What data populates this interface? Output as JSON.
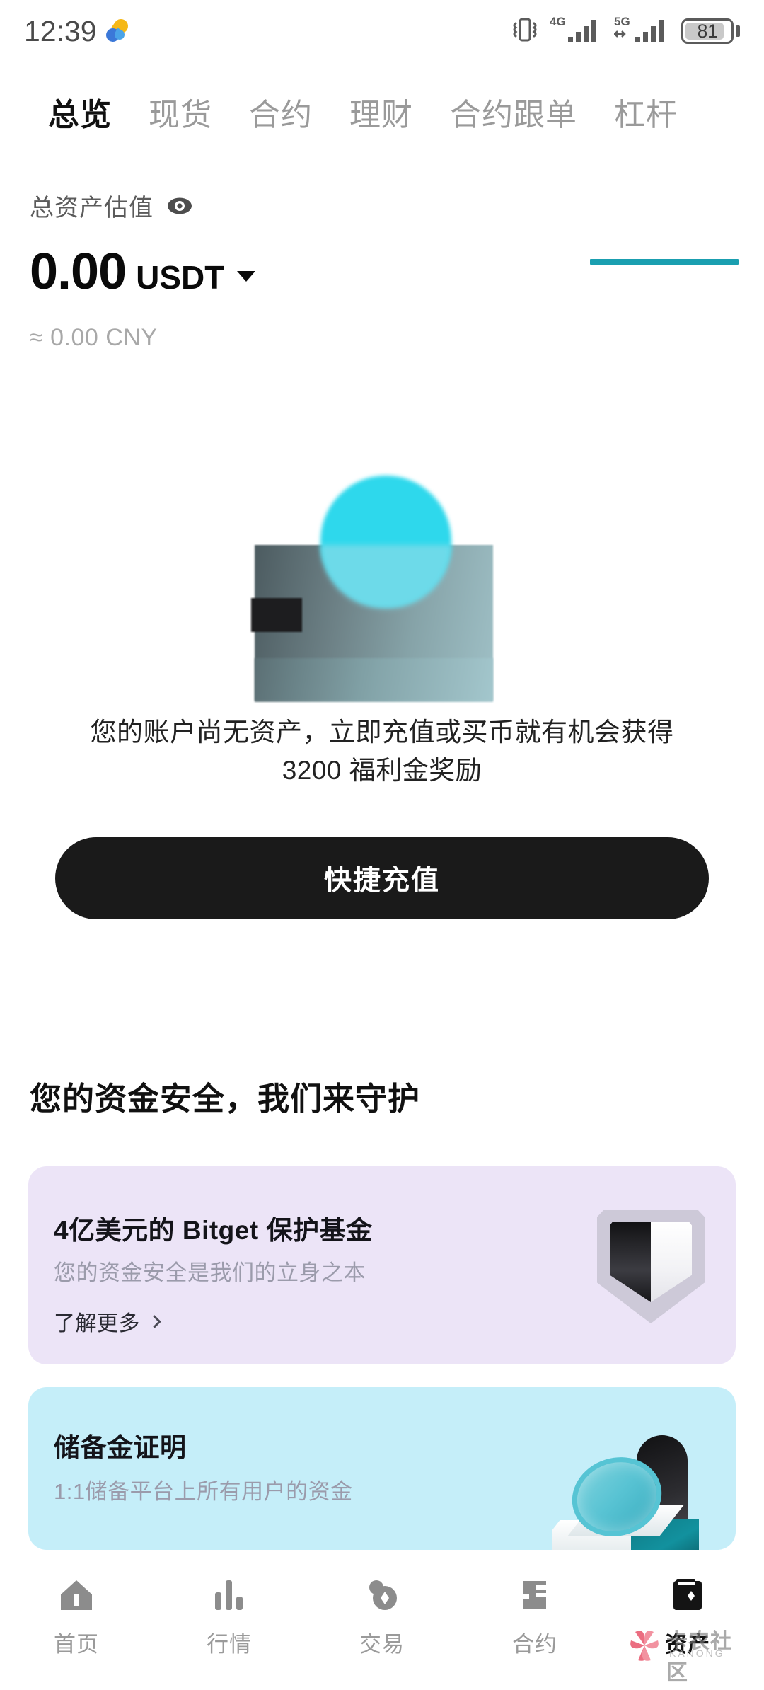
{
  "status_bar": {
    "time": "12:39",
    "app_icon": "pinwheel-icon",
    "vibrate_icon": "vibrate-icon",
    "signal_1_label": "4G",
    "signal_2_label": "5G",
    "battery_percent": "81"
  },
  "tabs": [
    {
      "label": "总览",
      "active": true
    },
    {
      "label": "现货",
      "active": false
    },
    {
      "label": "合约",
      "active": false
    },
    {
      "label": "理财",
      "active": false
    },
    {
      "label": "合约跟单",
      "active": false
    },
    {
      "label": "杠杆",
      "active": false
    }
  ],
  "balance": {
    "label": "总资产估值",
    "eye_icon": "eye-visible-icon",
    "amount": "0.00",
    "currency": "USDT",
    "currency_caret_icon": "caret-down-icon",
    "converted": "≈ 0.00 CNY",
    "accent_color": "#1a9fb0"
  },
  "empty_state": {
    "illustration": "empty-assets-illustration",
    "message": "您的账户尚无资产，立即充值或买币就有机会获得 3200 福利金奖励",
    "cta_label": "快捷充值",
    "cta_bg": "#1a1a1a"
  },
  "security": {
    "heading": "您的资金安全，我们来守护",
    "cards": [
      {
        "title": "4亿美元的 Bitget 保护基金",
        "desc": "您的资金安全是我们的立身之本",
        "link_label": "了解更多",
        "chevron_icon": "chevron-right-icon",
        "art": "shield-icon",
        "bg": "#ece4f7"
      },
      {
        "title": "储备金证明",
        "desc": "1:1储备平台上所有用户的资金",
        "art": "coin-magnifier-icon",
        "bg": "#c5eef9"
      }
    ]
  },
  "bottom_nav": [
    {
      "label": "首页",
      "icon": "home-icon",
      "active": false
    },
    {
      "label": "行情",
      "icon": "bar-chart-icon",
      "active": false
    },
    {
      "label": "交易",
      "icon": "swap-coins-icon",
      "active": false
    },
    {
      "label": "合约",
      "icon": "contract-icon",
      "active": false
    },
    {
      "label": "资产",
      "icon": "wallet-icon",
      "active": true
    }
  ],
  "watermark": {
    "text": "卡农社区",
    "subtext": "KANONG",
    "logo_icon": "flower-logo-icon"
  }
}
